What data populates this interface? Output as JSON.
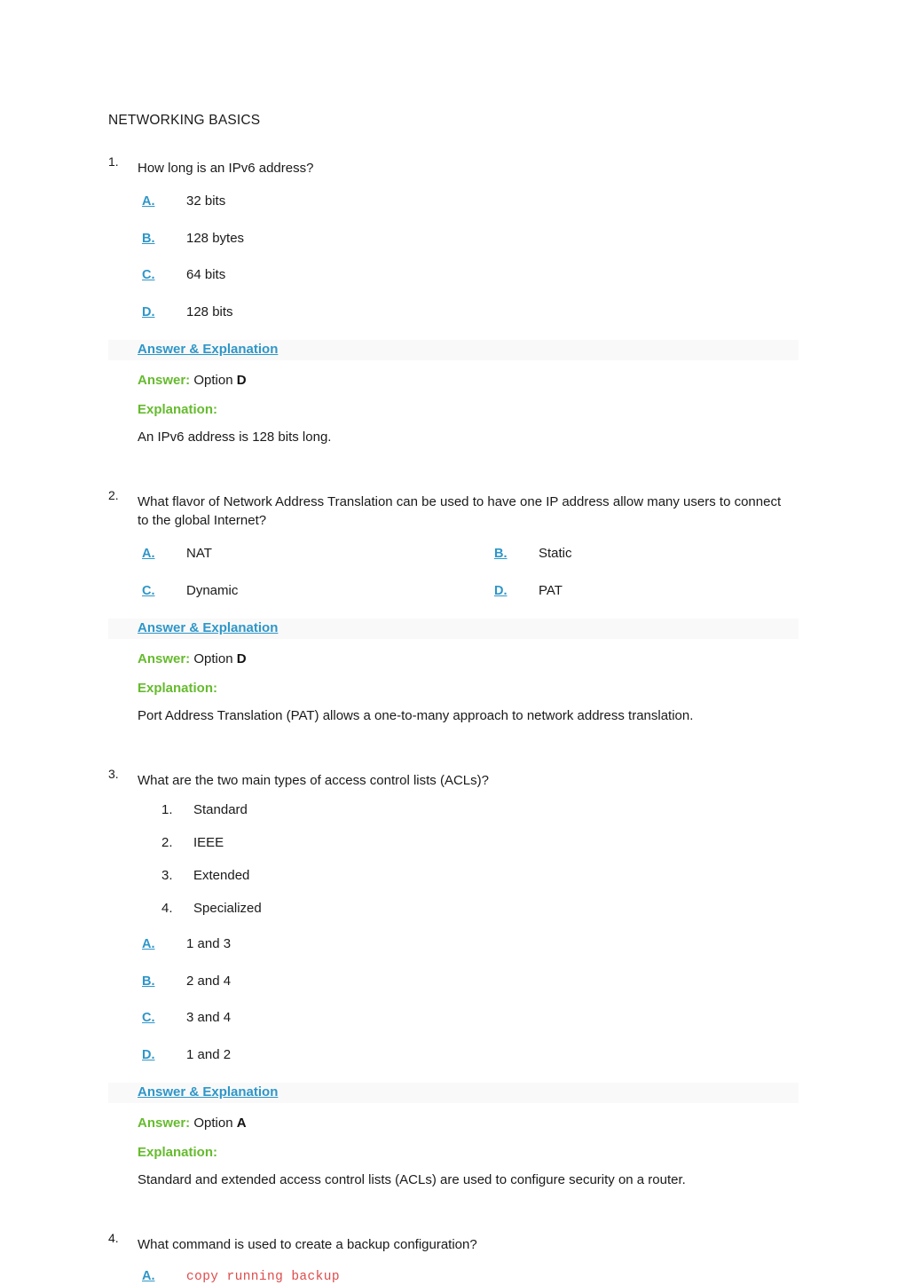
{
  "document": {
    "title": "NETWORKING BASICS"
  },
  "labels": {
    "answer_explanation_link": "Answer & Explanation",
    "answer_label": "Answer:",
    "answer_prefix": "Option",
    "explanation_label": "Explanation:"
  },
  "colors": {
    "link_blue": "#2e96c8",
    "accent_green": "#66bb2e",
    "code_red": "#de4b4b",
    "bar_gray": "#f9f9f9",
    "text": "#1a1a1a"
  },
  "questions": [
    {
      "number": "1.",
      "text": "How long is an IPv6 address?",
      "layout": "one-column",
      "options": [
        {
          "letter": "A.",
          "text": "32 bits",
          "code": false
        },
        {
          "letter": "B.",
          "text": "128 bytes",
          "code": false
        },
        {
          "letter": "C.",
          "text": "64 bits",
          "code": false
        },
        {
          "letter": "D.",
          "text": "128 bits",
          "code": false
        }
      ],
      "answer_letter": "D",
      "explanation": "An IPv6 address is 128 bits long."
    },
    {
      "number": "2.",
      "text": "What flavor of Network Address Translation can be used to have one IP address allow many users to connect to the global Internet?",
      "layout": "two-column",
      "options": [
        {
          "letter": "A.",
          "text": "NAT",
          "code": false
        },
        {
          "letter": "B.",
          "text": "Static",
          "code": false
        },
        {
          "letter": "C.",
          "text": "Dynamic",
          "code": false
        },
        {
          "letter": "D.",
          "text": "PAT",
          "code": false
        }
      ],
      "answer_letter": "D",
      "explanation": "Port Address Translation (PAT) allows a one-to-many approach to network address translation."
    },
    {
      "number": "3.",
      "text": "What are the two main types of access control lists (ACLs)?",
      "layout": "one-column",
      "sub_list": [
        {
          "num": "1.",
          "text": "Standard"
        },
        {
          "num": "2.",
          "text": "IEEE"
        },
        {
          "num": "3.",
          "text": "Extended"
        },
        {
          "num": "4.",
          "text": "Specialized"
        }
      ],
      "options": [
        {
          "letter": "A.",
          "text": "1 and 3",
          "code": false
        },
        {
          "letter": "B.",
          "text": "2 and 4",
          "code": false
        },
        {
          "letter": "C.",
          "text": "3 and 4",
          "code": false
        },
        {
          "letter": "D.",
          "text": "1 and 2",
          "code": false
        }
      ],
      "answer_letter": "A",
      "explanation": "Standard and extended access control lists (ACLs) are used to configure security on a router."
    },
    {
      "number": "4.",
      "text": "What command is used to create a backup configuration?",
      "layout": "one-column",
      "options": [
        {
          "letter": "A.",
          "text": "copy running backup",
          "code": true
        }
      ]
    }
  ]
}
